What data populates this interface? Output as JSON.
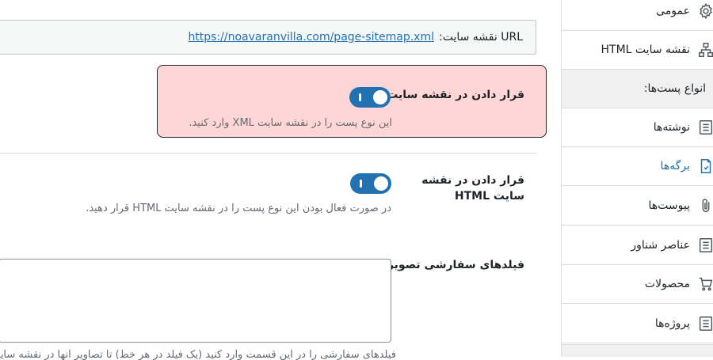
{
  "url_field": {
    "label": "URL نقشه سایت:",
    "url": "https://noavaranvilla.com/page-sitemap.xml"
  },
  "xml_option": {
    "title": "قرار دادن در نقشه سایت",
    "description": "این نوع پست را در نقشه سایت XML وارد کنید.",
    "enabled": true
  },
  "html_option": {
    "title": "قرار دادن در نقشه سایت HTML",
    "description": "در صورت فعال بودن این نوع پست را در نقشه سایت HTML قرار دهید.",
    "enabled": true
  },
  "custom_fields": {
    "title": "فیلدهای سفارشی تصویر",
    "textarea_value": "",
    "helper_text": "فیلدهای سفارشی را در این قسمت وارد کنید (یک فیلد در هر خط) تا تصاویر آنها در نقشه سایت قرار گیرد"
  },
  "sidebar": {
    "items": [
      {
        "label": "عمومی",
        "icon": "gear-icon"
      },
      {
        "label": "نقشه سایت HTML",
        "icon": "sitemap-icon"
      },
      {
        "label": "انواع پست‌ها:",
        "section": true
      },
      {
        "label": "نوشته‌ها",
        "icon": "document-icon"
      },
      {
        "label": "برگه‌ها",
        "icon": "page-icon",
        "active": true
      },
      {
        "label": "پیوست‌ها",
        "icon": "paperclip-icon"
      },
      {
        "label": "عناصر شناور",
        "icon": "document-icon"
      },
      {
        "label": "محصولات",
        "icon": "cart-icon"
      },
      {
        "label": "پروژه‌ها",
        "icon": "document-icon"
      }
    ]
  },
  "colors": {
    "accent": "#2271b1",
    "highlight_bg": "#ffd6d6"
  }
}
